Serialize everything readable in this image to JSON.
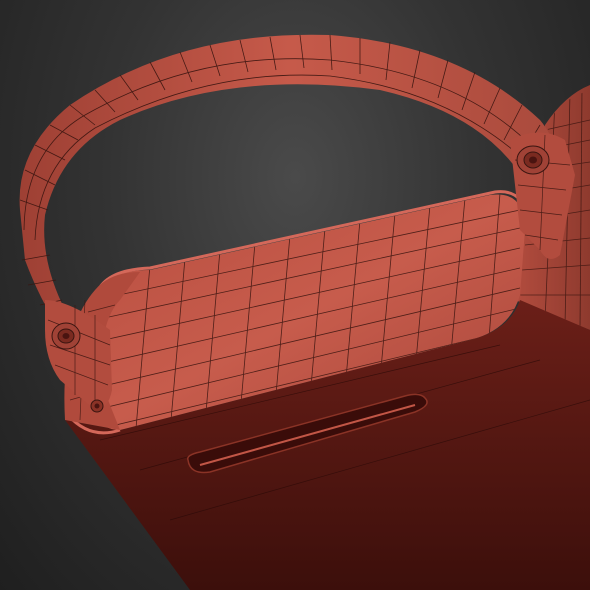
{
  "viewport": {
    "kind": "3d-wireframe-render",
    "subject": "red-mesh-box-with-strap-handle",
    "colors": {
      "background": "#303030",
      "mesh_light": "#c2584a",
      "mesh_mid": "#a6463a",
      "mesh_dark": "#4a1410",
      "wire": "#3a1510"
    }
  }
}
